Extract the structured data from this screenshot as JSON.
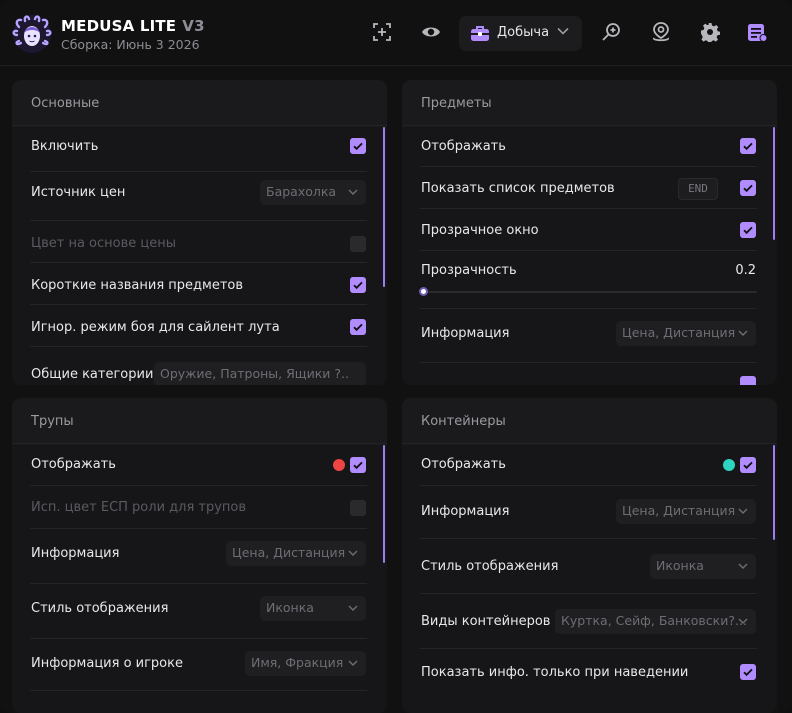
{
  "app": {
    "name": "MEDUSA LITE",
    "version": "V3",
    "build": "Сборка: Июнь 3 2026"
  },
  "header": {
    "loot_dropdown": "Добыча",
    "icons": [
      "crosshair-icon",
      "eye-icon",
      "briefcase-icon",
      "search-map-icon",
      "location-icon",
      "gear-icon",
      "list-icon"
    ]
  },
  "colors": {
    "accent": "#b18cff",
    "scrollbar": "#9f7cf2",
    "red_dot": "#ef4444",
    "teal_dot": "#2dd4bf"
  },
  "panels": {
    "basic": {
      "title": "Основные",
      "enable_label": "Включить",
      "enable_checked": true,
      "price_source_label": "Источник цен",
      "price_source_value": "Барахолка",
      "price_color_label": "Цвет на основе цены",
      "price_color_checked": false,
      "short_names_label": "Короткие названия предметов",
      "short_names_checked": true,
      "ignore_combat_label": "Игнор. режим боя для сайлент лута",
      "ignore_combat_checked": true,
      "categories_label": "Общие категории",
      "categories_value": "Оружие, Патроны, Ящики ?.."
    },
    "items": {
      "title": "Предметы",
      "show_label": "Отображать",
      "show_checked": true,
      "show_list_label": "Показать список предметов",
      "show_list_key": "END",
      "show_list_checked": true,
      "transparent_label": "Прозрачное окно",
      "transparent_checked": true,
      "opacity_label": "Прозрачность",
      "opacity_value": "0.2",
      "opacity_fraction": 0.0,
      "info_label": "Информация",
      "info_value": "Цена, Дистанция"
    },
    "corpses": {
      "title": "Трупы",
      "show_label": "Отображать",
      "show_checked": true,
      "esp_color_label": "Исп. цвет ЕСП роли для трупов",
      "esp_color_checked": false,
      "info_label": "Информация",
      "info_value": "Цена, Дистанция",
      "style_label": "Стиль отображения",
      "style_value": "Иконка",
      "player_info_label": "Информация о игроке",
      "player_info_value": "Имя, Фракция"
    },
    "containers": {
      "title": "Контейнеры",
      "show_label": "Отображать",
      "show_checked": true,
      "info_label": "Информация",
      "info_value": "Цена, Дистанция",
      "style_label": "Стиль отображения",
      "style_value": "Иконка",
      "types_label": "Виды контейнеров",
      "types_value": "Куртка, Сейф, Банковски?...",
      "hover_label": "Показать инфо. только при наведении",
      "hover_checked": true
    }
  }
}
